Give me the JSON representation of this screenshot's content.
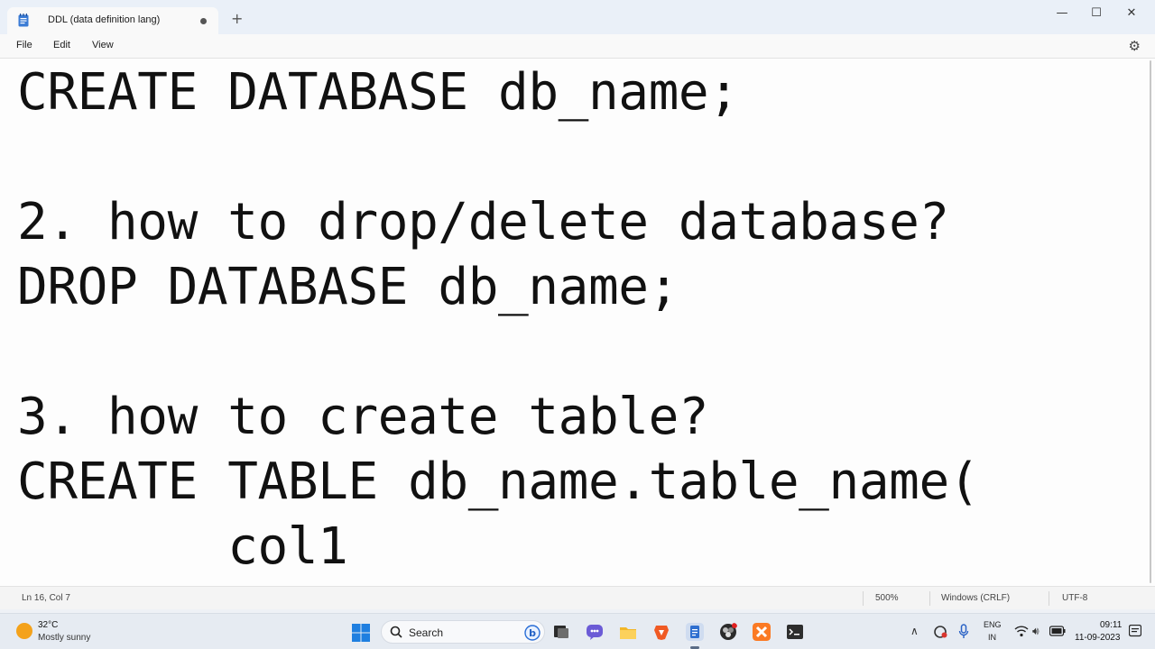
{
  "window": {
    "tab_title": "DDL (data definition lang)",
    "new_tab_label": "+",
    "minimize_label": "—",
    "maximize_label": "☐",
    "close_label": "✕"
  },
  "menu": {
    "items": [
      "File",
      "Edit",
      "View"
    ],
    "settings_glyph": "⚙"
  },
  "editor": {
    "lines": [
      "CREATE DATABASE db_name;",
      "2. how to drop/delete database?",
      "DROP DATABASE db_name;",
      "3. how to create table?",
      "CREATE TABLE db_name.table_name(",
      "       col1"
    ]
  },
  "status": {
    "position": "Ln 16, Col 7",
    "zoom": "500%",
    "line_ending": "Windows (CRLF)",
    "encoding": "UTF-8"
  },
  "taskbar": {
    "weather_temp": "32°C",
    "weather_desc": "Mostly sunny",
    "search_label": "Search",
    "lang_line1": "ENG",
    "lang_line2": "IN",
    "time": "09:11",
    "date": "11-09-2023"
  },
  "colors": {
    "accent": "#0067c0",
    "notepad_blue": "#2b6cb0"
  }
}
